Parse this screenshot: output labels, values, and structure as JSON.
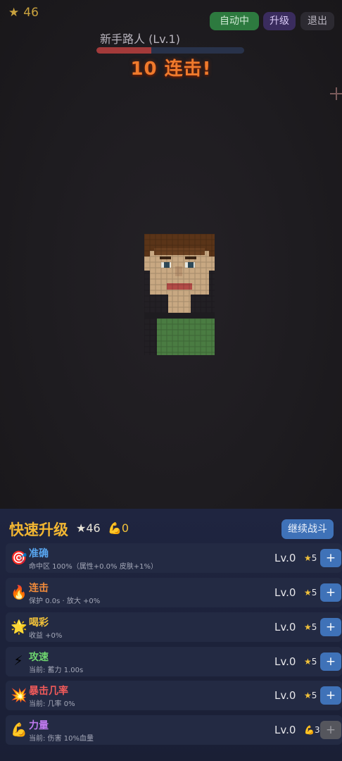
{
  "hud": {
    "star_icon": "★",
    "stars": "46",
    "auto_label": "自动中",
    "upgrade_label": "升级",
    "exit_label": "退出"
  },
  "enemy": {
    "name": "新手路人 (Lv.1)",
    "hp_fraction": 0.37,
    "combo_text": "10 连击!"
  },
  "upgrade_panel": {
    "title": "快速升级",
    "stars": "★46",
    "muscle": "💪0",
    "continue_label": "继续战斗",
    "items": [
      {
        "icon": "🎯",
        "name": "准确",
        "desc": "命中区 100%（属性+0.0% 皮肤+1%）",
        "level": "Lv.0",
        "cost_icon": "★",
        "cost": "5",
        "name_color": "#58a6f0",
        "enabled": true
      },
      {
        "icon": "🔥",
        "name": "连击",
        "desc": "保护 0.0s · 放大 +0%",
        "level": "Lv.0",
        "cost_icon": "★",
        "cost": "5",
        "name_color": "#f08a3a",
        "enabled": true
      },
      {
        "icon": "🌟",
        "name": "喝彩",
        "desc": "收益 +0%",
        "level": "Lv.0",
        "cost_icon": "★",
        "cost": "5",
        "name_color": "#f2c23a",
        "enabled": true
      },
      {
        "icon": "⚡",
        "name": "攻速",
        "desc": "当前: 蓄力 1.00s",
        "level": "Lv.0",
        "cost_icon": "★",
        "cost": "5",
        "name_color": "#6fd66f",
        "enabled": true
      },
      {
        "icon": "💥",
        "name": "暴击几率",
        "desc": "当前: 几率 0%",
        "level": "Lv.0",
        "cost_icon": "★",
        "cost": "5",
        "name_color": "#f05a5a",
        "enabled": true
      },
      {
        "icon": "💪",
        "name": "力量",
        "desc": "当前: 伤害 10%血量",
        "level": "Lv.0",
        "cost_icon": "💪",
        "cost": "3",
        "name_color": "#c07af0",
        "enabled": false
      }
    ]
  }
}
